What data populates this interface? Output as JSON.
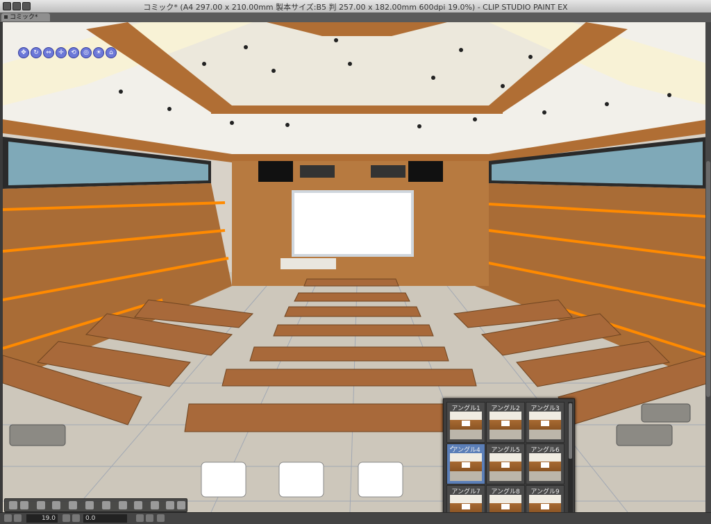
{
  "window": {
    "title": "コミック* (A4 297.00 x 210.00mm 製本サイズ:B5 判 257.00 x 182.00mm 600dpi 19.0%)  - CLIP STUDIO PAINT EX"
  },
  "tabs": [
    {
      "label": "コミック*"
    }
  ],
  "view_tools": [
    {
      "icon": "camera-move-icon"
    },
    {
      "icon": "camera-rotate-icon"
    },
    {
      "icon": "camera-pan-icon"
    },
    {
      "icon": "object-move-icon"
    },
    {
      "icon": "object-rotate-icon"
    },
    {
      "icon": "object-scale-icon"
    },
    {
      "icon": "object-light-icon"
    },
    {
      "icon": "object-reset-icon"
    }
  ],
  "angle_panel": {
    "items": [
      {
        "label": "アングル1",
        "selected": false
      },
      {
        "label": "アングル2",
        "selected": false
      },
      {
        "label": "アングル3",
        "selected": false
      },
      {
        "label": "アングル4",
        "selected": true
      },
      {
        "label": "アングル5",
        "selected": false
      },
      {
        "label": "アングル6",
        "selected": false
      },
      {
        "label": "アングル7",
        "selected": false
      },
      {
        "label": "アングル8",
        "selected": false
      },
      {
        "label": "アングル9",
        "selected": false
      }
    ]
  },
  "statusbar": {
    "zoom": "19.0",
    "angle": "0.0"
  },
  "colors": {
    "wood": "#b06e34",
    "stripe": "#ff8a00",
    "ceiling": "#f2f0ea",
    "floor": "#c8c2b6",
    "accent": "#6c78d8"
  }
}
